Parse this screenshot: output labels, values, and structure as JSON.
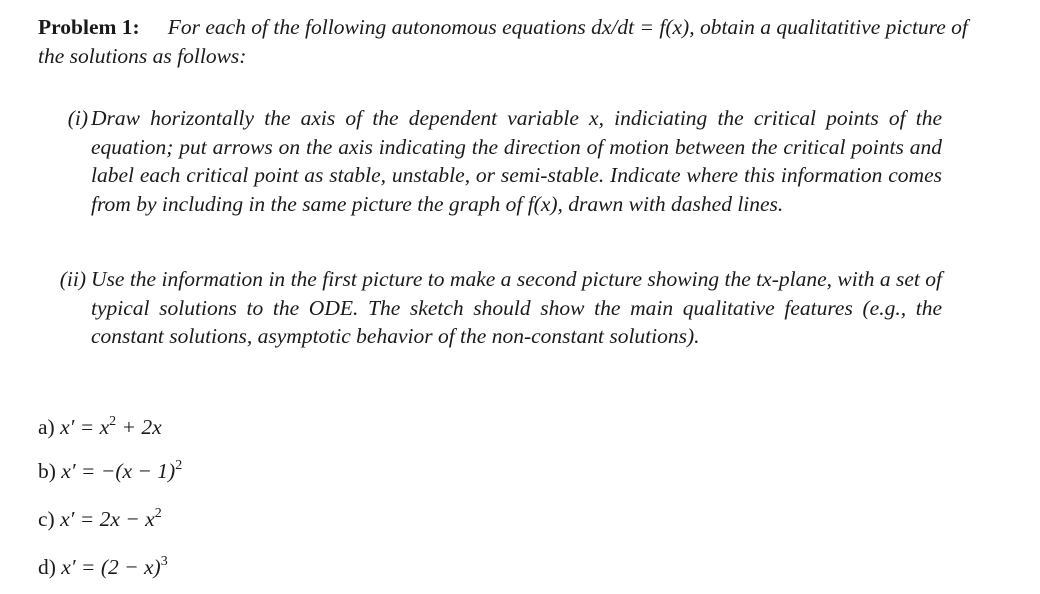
{
  "problem": {
    "label": "Problem 1:",
    "intro": "For each of the following autonomous equations dx/dt = f(x), obtain a qualitatitive picture of the solutions as follows:"
  },
  "items": [
    {
      "number": "(i)",
      "text": "Draw horizontally the axis of the dependent variable x, indiciating the critical points of the equation; put arrows on the axis indicating the direction of motion between the critical points and label each critical point as stable, unstable, or semi-stable. Indicate where this information comes from by including in the same picture the graph of f(x), drawn with dashed lines."
    },
    {
      "number": "(ii)",
      "text": "Use the information in the first picture to make a second picture showing the tx-plane, with a set of typical solutions to the ODE. The sketch should show the main qualitative features (e.g., the constant solutions, asymptotic behavior of the non-constant solutions)."
    }
  ],
  "equations": [
    {
      "label": "a)",
      "lhs": "x′ =",
      "rhs_1": "x",
      "power_1": "2",
      "rhs_2": " + 2x",
      "power_2": ""
    },
    {
      "label": "b)",
      "lhs": "x′ =",
      "rhs_1": "−(x − 1)",
      "power_1": "2",
      "rhs_2": "",
      "power_2": ""
    },
    {
      "label": "c)",
      "lhs": "x′ =",
      "rhs_1": "2x − x",
      "power_1": "2",
      "rhs_2": "",
      "power_2": ""
    },
    {
      "label": "d)",
      "lhs": "x′ =",
      "rhs_1": "(2 − x)",
      "power_1": "3",
      "rhs_2": "",
      "power_2": ""
    }
  ]
}
